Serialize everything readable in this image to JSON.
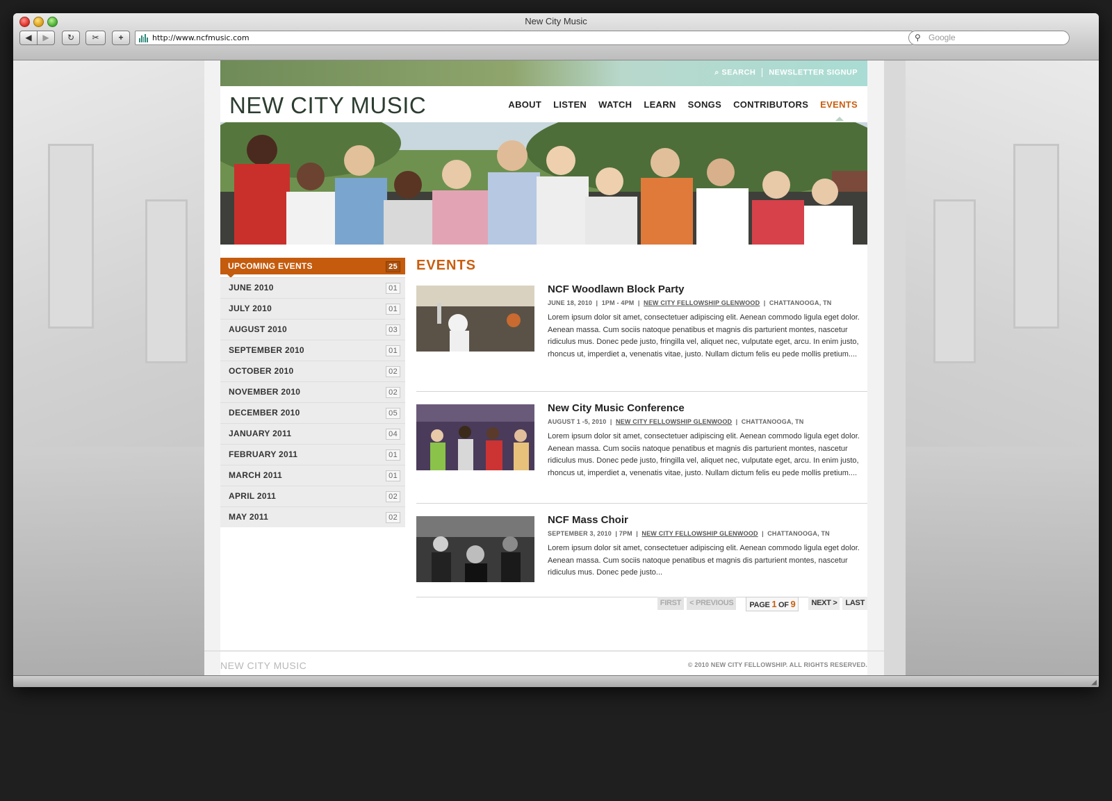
{
  "browser": {
    "title": "New City Music",
    "url": "http://www.ncfmusic.com",
    "search_placeholder": "Google"
  },
  "utility_nav": {
    "search": "SEARCH",
    "newsletter": "NEWSLETTER SIGNUP"
  },
  "logo": "NEW CITY MUSIC",
  "main_nav": [
    "ABOUT",
    "LISTEN",
    "WATCH",
    "LEARN",
    "SONGS",
    "CONTRIBUTORS",
    "EVENTS"
  ],
  "active_nav": "EVENTS",
  "sidebar": {
    "header": "UPCOMING EVENTS",
    "header_count": "25",
    "months": [
      {
        "label": "JUNE 2010",
        "count": "01"
      },
      {
        "label": "JULY 2010",
        "count": "01"
      },
      {
        "label": "AUGUST 2010",
        "count": "03"
      },
      {
        "label": "SEPTEMBER 2010",
        "count": "01"
      },
      {
        "label": "OCTOBER 2010",
        "count": "02"
      },
      {
        "label": "NOVEMBER 2010",
        "count": "02"
      },
      {
        "label": "DECEMBER 2010",
        "count": "05"
      },
      {
        "label": "JANUARY 2011",
        "count": "04"
      },
      {
        "label": "FEBRUARY 2011",
        "count": "01"
      },
      {
        "label": "MARCH 2011",
        "count": "01"
      },
      {
        "label": "APRIL 2011",
        "count": "02"
      },
      {
        "label": "MAY 2011",
        "count": "02"
      }
    ]
  },
  "content": {
    "title": "EVENTS",
    "events": [
      {
        "title": "NCF Woodlawn Block Party",
        "date": "JUNE 18, 2010",
        "time": "1PM - 4PM",
        "venue": "NEW CITY FELLOWSHIP GLENWOOD",
        "location": "CHATTANOOGA, TN",
        "desc": "Lorem ipsum dolor sit amet, consectetuer adipiscing elit. Aenean commodo ligula eget dolor. Aenean massa. Cum sociis natoque penatibus et magnis dis parturient montes, nascetur ridiculus mus. Donec pede justo, fringilla vel, aliquet nec, vulputate eget, arcu. In enim justo, rhoncus ut, imperdiet a, venenatis vitae, justo. Nullam dictum felis eu pede mollis pretium...."
      },
      {
        "title": "New City Music Conference",
        "date": "AUGUST 1 -5, 2010",
        "time": "",
        "venue": "NEW CITY FELLOWSHIP GLENWOOD",
        "location": "CHATTANOOGA, TN",
        "desc": "Lorem ipsum dolor sit amet, consectetuer adipiscing elit. Aenean commodo ligula eget dolor. Aenean massa. Cum sociis natoque penatibus et magnis dis parturient montes, nascetur ridiculus mus. Donec pede justo, fringilla vel, aliquet nec, vulputate eget, arcu. In enim justo, rhoncus ut, imperdiet a, venenatis vitae, justo. Nullam dictum felis eu pede mollis pretium...."
      },
      {
        "title": "NCF Mass Choir",
        "date": "SEPTEMBER 3, 2010",
        "time": "7PM",
        "venue": "NEW CITY FELLOWSHIP GLENWOOD",
        "location": "CHATTANOOGA, TN",
        "desc": "Lorem ipsum dolor sit amet, consectetuer adipiscing elit. Aenean commodo ligula eget dolor. Aenean massa. Cum sociis natoque penatibus et magnis dis parturient montes, nascetur ridiculus mus. Donec pede justo..."
      }
    ]
  },
  "pager": {
    "first": "FIRST",
    "prev": "< PREVIOUS",
    "page_prefix": "PAGE",
    "current": "1",
    "of": "OF",
    "total": "9",
    "next": "NEXT >",
    "last": "LAST"
  },
  "footer": {
    "logo": "NEW CITY MUSIC",
    "copyright": "© 2010 NEW CITY FELLOWSHIP. ALL RIGHTS RESERVED."
  },
  "colors": {
    "accent": "#c95e10",
    "text": "#222222",
    "sidebar_bg": "#ececec"
  }
}
